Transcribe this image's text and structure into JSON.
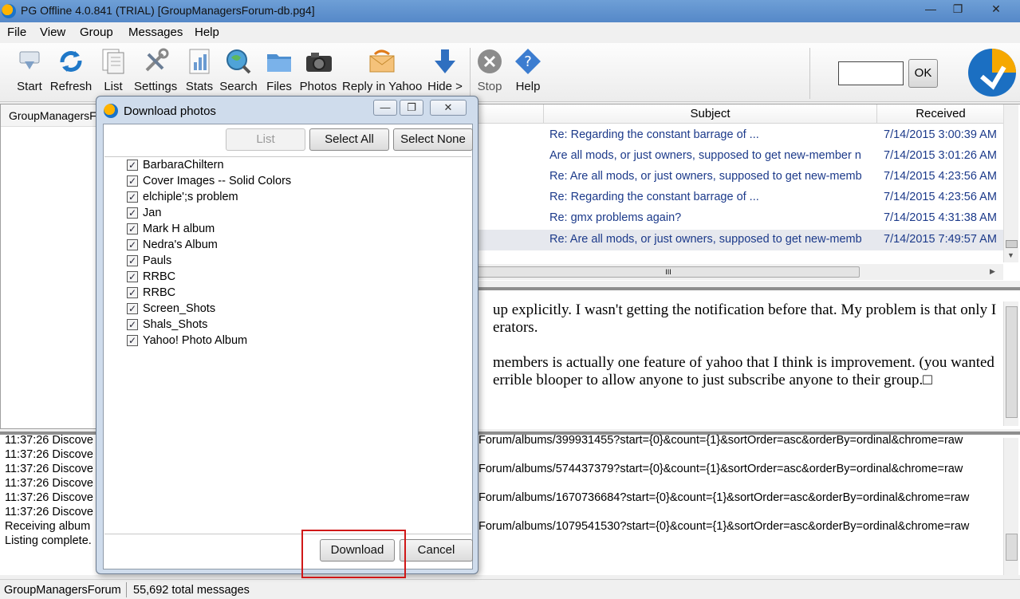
{
  "window": {
    "title": "PG Offline 4.0.841 (TRIAL) [GroupManagersForum-db.pg4]",
    "minimize": "—",
    "maximize": "❐",
    "close": "✕"
  },
  "menu": [
    "File",
    "View",
    "Group",
    "Messages",
    "Help"
  ],
  "toolbar": {
    "start": "Start",
    "refresh": "Refresh",
    "list": "List",
    "settings": "Settings",
    "stats": "Stats",
    "search": "Search",
    "files": "Files",
    "photos": "Photos",
    "reply_in_yahoo": "Reply in Yahoo",
    "hide": "Hide >",
    "stop": "Stop",
    "help": "Help",
    "ok": "OK",
    "input_value": ""
  },
  "left_panel": {
    "group_tab": "GroupManagersForum"
  },
  "message_list": {
    "columns": {
      "subject": "Subject",
      "received": "Received"
    },
    "rows": [
      {
        "subject": "Re: Regarding the constant barrage of ...",
        "received": "7/14/2015 3:00:39 AM"
      },
      {
        "subject": "Are all mods, or just owners, supposed to get new-member n",
        "received": "7/14/2015 3:01:26 AM"
      },
      {
        "subject": "Re: Are all mods, or just owners, supposed to get new-memb",
        "received": "7/14/2015 4:23:56 AM"
      },
      {
        "subject": "Re: Regarding the constant barrage of ...",
        "received": "7/14/2015 4:23:56 AM"
      },
      {
        "subject": "Re: gmx problems again?",
        "received": "7/14/2015 4:31:38 AM"
      },
      {
        "subject": "Re: Are all mods, or just owners, supposed to get new-memb",
        "received": "7/14/2015 7:49:57 AM"
      }
    ],
    "hscroll_grip": "III"
  },
  "preview": {
    "lines": [
      "up explicitly. I wasn't getting the notification before that. My problem is that only I",
      "erators.",
      "members is actually one feature of yahoo that I think is improvement. (you wanted",
      "errible blooper to allow anyone to just subscribe anyone to their group.□"
    ]
  },
  "log": {
    "left": [
      "11:37:26 Discove",
      "11:37:26 Discove",
      "11:37:26 Discove",
      "11:37:26 Discove",
      "11:37:26 Discove",
      "11:37:26 Discove",
      "Receiving album",
      "Listing complete."
    ],
    "right": [
      "Forum/albums/399931455?start={0}&count={1}&sortOrder=asc&orderBy=ordinal&chrome=raw",
      "Forum/albums/574437379?start={0}&count={1}&sortOrder=asc&orderBy=ordinal&chrome=raw",
      "Forum/albums/1670736684?start={0}&count={1}&sortOrder=asc&orderBy=ordinal&chrome=raw",
      "Forum/albums/1079541530?start={0}&count={1}&sortOrder=asc&orderBy=ordinal&chrome=raw"
    ]
  },
  "status": {
    "group": "GroupManagersForum",
    "total": "55,692 total messages"
  },
  "dialog": {
    "title": "Download photos",
    "list_button": "List",
    "select_all": "Select All",
    "select_none": "Select None",
    "albums": [
      "BarbaraChiltern",
      "Cover Images -- Solid Colors",
      "elchiple';s problem",
      "Jan",
      "Mark H album",
      "Nedra's Album",
      "Pauls",
      "RRBC",
      "RRBC",
      "Screen_Shots",
      "Shals_Shots",
      "Yahoo! Photo Album"
    ],
    "checkmark": "✓",
    "download": "Download",
    "cancel": "Cancel"
  },
  "colors": {
    "link_text": "#1c3a8a",
    "highlight": "#d01818",
    "title_bar": "#5f93d0"
  }
}
